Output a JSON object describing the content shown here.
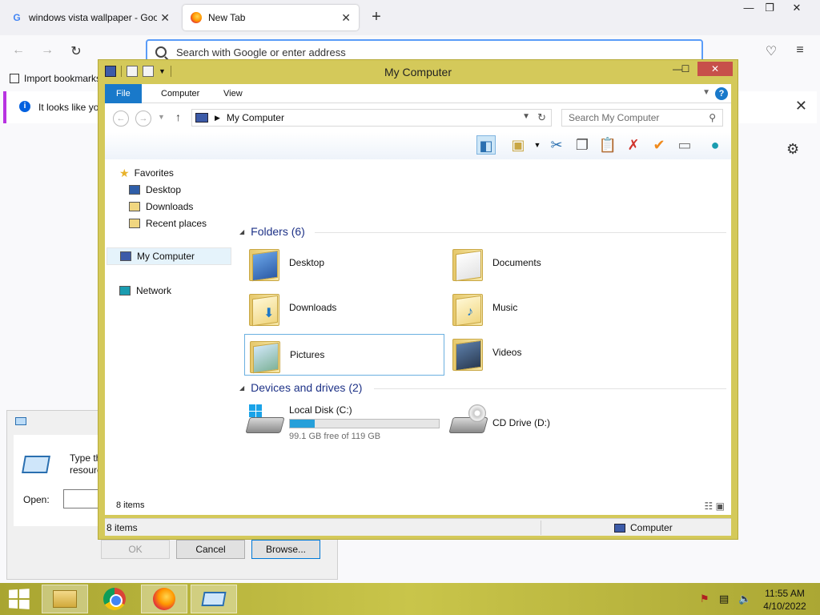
{
  "browser": {
    "tabs": [
      {
        "title": "windows vista wallpaper - Google"
      },
      {
        "title": "New Tab"
      }
    ],
    "new_tab": "+",
    "window_controls": {
      "minimize": "—",
      "restore": "❐",
      "close": "✕"
    },
    "nav": {
      "back": "←",
      "forward": "→",
      "reload": "↻",
      "pocket": "♡",
      "menu": "≡"
    },
    "urlbar": {
      "placeholder": "Search with Google or enter address"
    },
    "bookmarks": {
      "import_label": "Import bookmarks..."
    },
    "notification": {
      "message": "It looks like you",
      "close": "✕"
    },
    "settings_icon": "⚙"
  },
  "run_dialog": {
    "description_line1": "Type the",
    "description_line2": "resource",
    "open_label": "Open:",
    "ok_label": "OK",
    "cancel_label": "Cancel",
    "browse_label": "Browse..."
  },
  "explorer": {
    "title": "My Computer",
    "minimize": "—",
    "maximize": "☐",
    "close": "✕",
    "ribbon_tabs": [
      "File",
      "Computer",
      "View"
    ],
    "help": "?",
    "address": "My Computer",
    "search_placeholder": "Search My Computer",
    "nav_pane": {
      "favorites": "Favorites",
      "desktop": "Desktop",
      "downloads": "Downloads",
      "recent": "Recent places",
      "computer": "My Computer",
      "network": "Network"
    },
    "folders_group": "Folders (6)",
    "folders": [
      {
        "name": "Desktop"
      },
      {
        "name": "Documents"
      },
      {
        "name": "Downloads"
      },
      {
        "name": "Music"
      },
      {
        "name": "Pictures"
      },
      {
        "name": "Videos"
      }
    ],
    "devices_group": "Devices and drives (2)",
    "drives": [
      {
        "name": "Local Disk (C:)",
        "free_text": "99.1 GB free of 119 GB",
        "used_fraction": 0.167
      },
      {
        "name": "CD Drive (D:)"
      }
    ],
    "item_count": "8 items",
    "status": {
      "left": "8 items",
      "right": "Computer"
    }
  },
  "taskbar": {
    "time": "11:55 AM",
    "date": "4/10/2022"
  }
}
